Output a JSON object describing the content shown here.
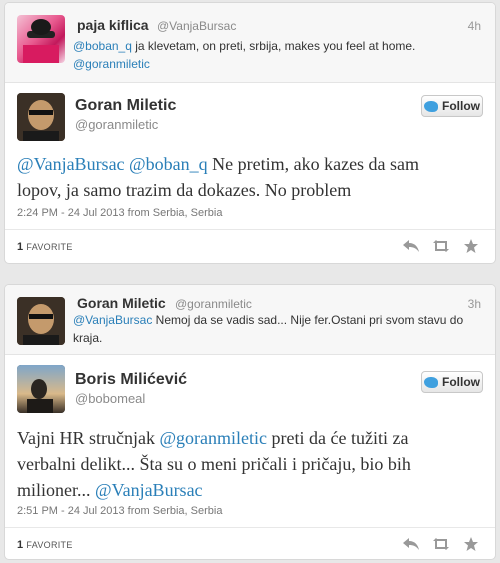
{
  "thread1": {
    "reply": {
      "name": "paja kiflica",
      "handle": "@VanjaBursac",
      "time": "4h",
      "mention1": "@boban_q",
      "text": " ja klevetam, on preti, srbija, makes you feel at home.",
      "mention2": "@goranmiletic"
    },
    "tweet": {
      "name": "Goran Miletic",
      "handle": "@goranmiletic",
      "follow_label": "Follow",
      "mention1": "@VanjaBursac",
      "mention2": "@boban_q",
      "text_line1": " Ne pretim, ako kazes da sam",
      "text_line2": "lopov, ja samo trazim da dokazes. No problem",
      "meta": "2:24 PM - 24 Jul 2013 from Serbia, Serbia",
      "fav_count": "1",
      "fav_label": "Favorite"
    }
  },
  "thread2": {
    "reply": {
      "name": "Goran Miletic",
      "handle": "@goranmiletic",
      "time": "3h",
      "mention1": "@VanjaBursac",
      "text_line1": " Nemoj da se vadis sad... Nije fer.Ostani pri svom stavu do",
      "text_line2": "kraja."
    },
    "tweet": {
      "name": "Boris Milićević",
      "handle": "@bobomeal",
      "follow_label": "Follow",
      "text_line1a": "Vajni HR stručnjak ",
      "mention1": "@goranmiletic",
      "text_line1b": " preti da će tužiti za",
      "text_line2": "verbalni delikt... Šta su o meni pričali i pričaju, bio bih",
      "text_line3": "milioner... ",
      "mention2": "@VanjaBursac",
      "meta": "2:51 PM - 24 Jul 2013 from Serbia, Serbia",
      "fav_count": "1",
      "fav_label": "Favorite"
    }
  },
  "icons": [
    "reply-icon",
    "retweet-icon",
    "favorite-star-icon",
    "twitter-bird-icon"
  ],
  "colors": {
    "mention": "#2a7fb8",
    "bird": "#3fa0df",
    "background": "#e8e8e8"
  }
}
